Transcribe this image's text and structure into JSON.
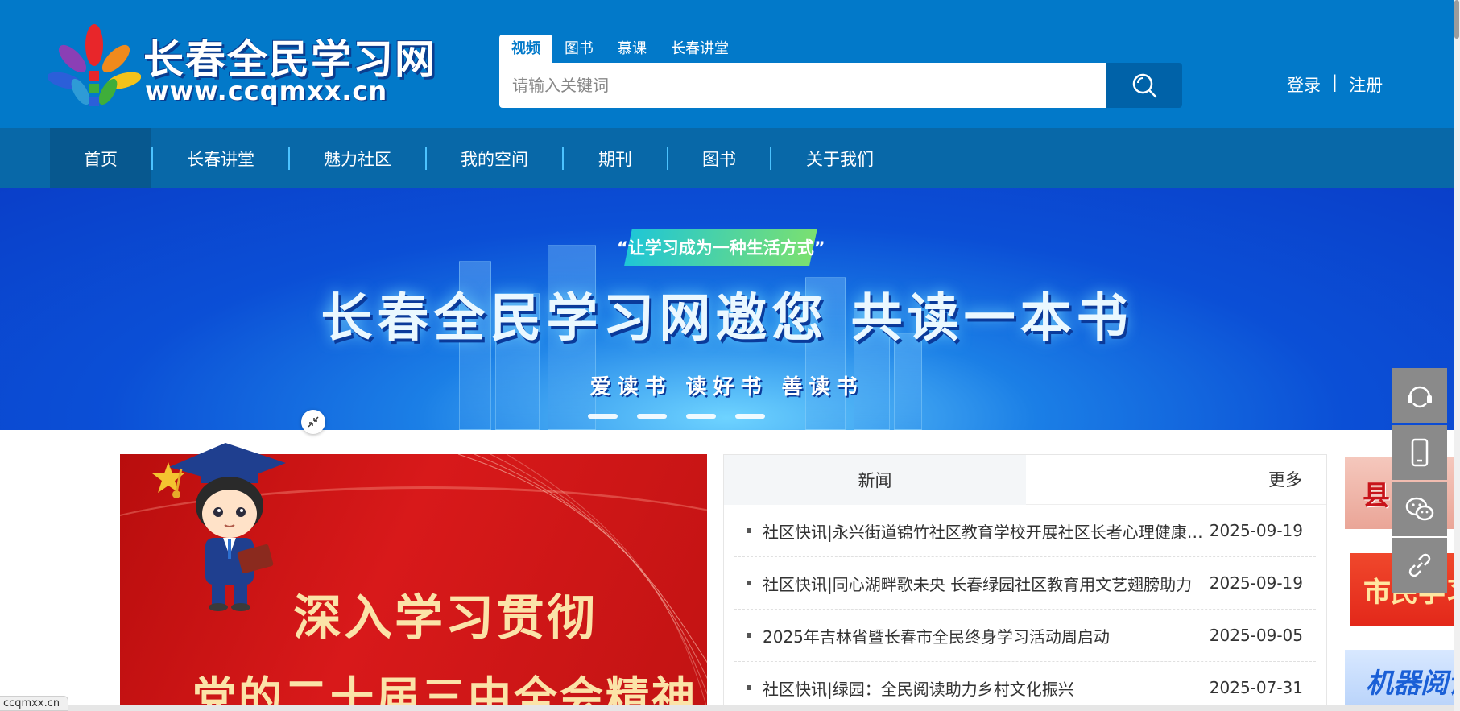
{
  "header": {
    "logo_title": "长春全民学习网",
    "logo_url": "www.ccqmxx.cn",
    "search_tabs": [
      {
        "label": "视频",
        "active": true
      },
      {
        "label": "图书",
        "active": false
      },
      {
        "label": "慕课",
        "active": false
      },
      {
        "label": "长春讲堂",
        "active": false
      }
    ],
    "search_placeholder": "请输入关键词",
    "login_label": "登录",
    "auth_separator": "|",
    "register_label": "注册"
  },
  "nav": {
    "items": [
      {
        "label": "首页",
        "active": true
      },
      {
        "label": "长春讲堂",
        "active": false
      },
      {
        "label": "魅力社区",
        "active": false
      },
      {
        "label": "我的空间",
        "active": false
      },
      {
        "label": "期刊",
        "active": false
      },
      {
        "label": "图书",
        "active": false
      },
      {
        "label": "关于我们",
        "active": false
      }
    ]
  },
  "banner": {
    "slogan": "“让学习成为一种生活方式”",
    "title": "长春全民学习网邀您 共读一本书",
    "subtitle": "爱读书 读好书 善读书",
    "slide_count": 4
  },
  "feature": {
    "line1": "深入学习贯彻",
    "line2": "党的二十届三中全会精神"
  },
  "news": {
    "tab_label": "新闻",
    "more_label": "更多",
    "items": [
      {
        "title": "社区快讯|永兴街道锦竹社区教育学校开展社区长者心理健康讲座",
        "date": "2025-09-19"
      },
      {
        "title": "社区快讯|同心湖畔歌未央 长春绿园社区教育用文艺翅膀助力",
        "date": "2025-09-19"
      },
      {
        "title": "2025年吉林省暨长春市全民终身学习活动周启动",
        "date": "2025-09-05"
      },
      {
        "title": "社区快讯|绿园：全民阅读助力乡村文化振兴",
        "date": "2025-07-31"
      }
    ]
  },
  "side_thumbs": [
    "县",
    "市民学习",
    "机器阅读"
  ],
  "floating_tools": [
    "customer-service-icon",
    "mobile-icon",
    "wechat-icon",
    "link-icon"
  ],
  "status_bar": {
    "url": "ccqmxx.cn"
  },
  "colors": {
    "header_bg": "#0279c9",
    "nav_bg": "#0868a8",
    "nav_active": "#07588f",
    "accent": "#4cc3ff"
  }
}
